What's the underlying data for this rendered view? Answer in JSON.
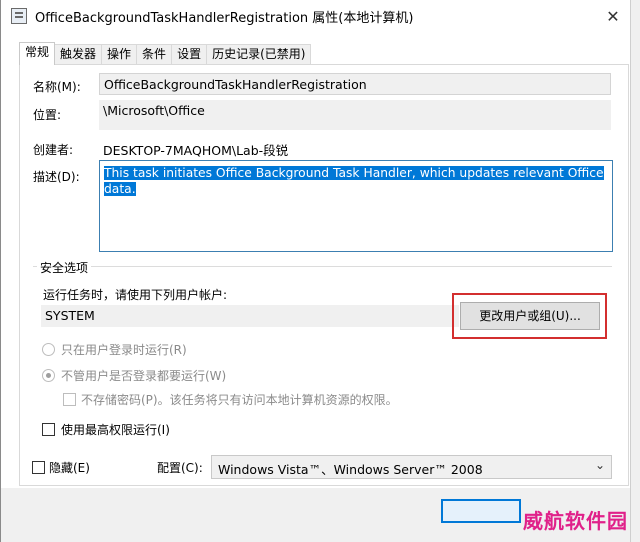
{
  "window": {
    "title": "OfficeBackgroundTaskHandlerRegistration 属性(本地计算机)",
    "close_glyph": "✕"
  },
  "tabs": [
    "常规",
    "触发器",
    "操作",
    "条件",
    "设置",
    "历史记录(已禁用)"
  ],
  "general": {
    "name_label": "名称(M):",
    "name_value": "OfficeBackgroundTaskHandlerRegistration",
    "location_label": "位置:",
    "location_value": "\\Microsoft\\Office",
    "author_label": "创建者:",
    "author_value": "DESKTOP-7MAQHOM\\Lab-段锐",
    "desc_label": "描述(D):",
    "desc_value": "This task initiates Office Background Task Handler, which updates relevant Office data."
  },
  "security": {
    "group_title": "安全选项",
    "run_as_label": "运行任务时，请使用下列用户帐户:",
    "account_value": "SYSTEM",
    "change_user_button": "更改用户或组(U)...",
    "radio_logged_on": "只在用户登录时运行(R)",
    "radio_whether": "不管用户是否登录都要运行(W)",
    "no_store_password": "不存储密码(P)。该任务将只有访问本地计算机资源的权限。",
    "highest_privileges": "使用最高权限运行(I)"
  },
  "bottom": {
    "hidden_label": "隐藏(E)",
    "configure_label": "配置(C):",
    "configure_value": "Windows Vista™、Windows Server™ 2008"
  },
  "watermark": "威航软件园",
  "colors": {
    "selection": "#0078d7",
    "highlight_box": "#d32f2f",
    "watermark": "#e0218a"
  }
}
